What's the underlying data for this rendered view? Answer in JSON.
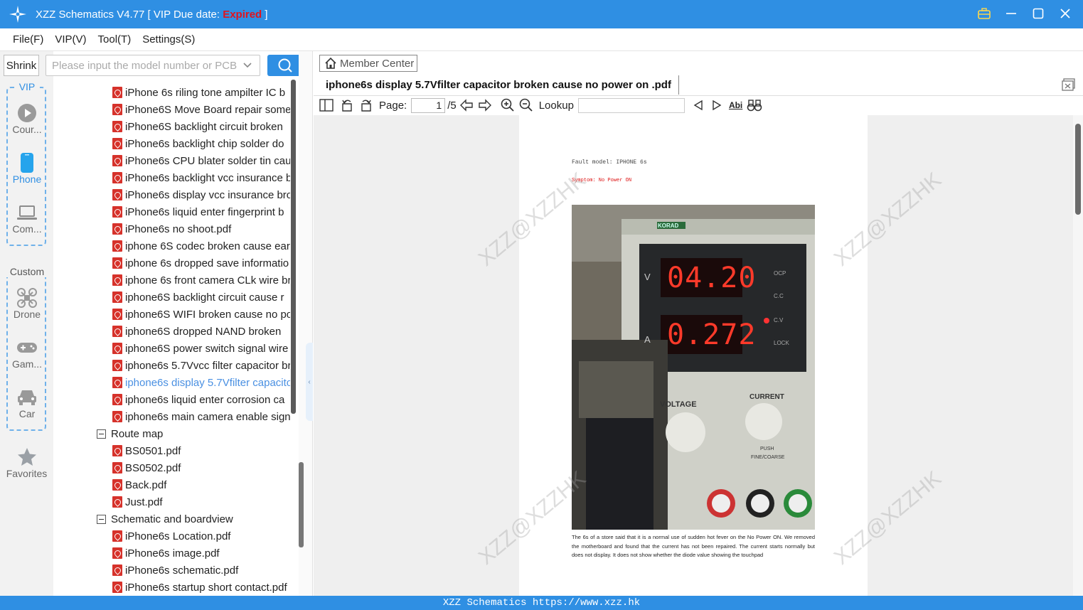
{
  "window": {
    "title_prefix": "XZZ Schematics V4.77 [ VIP Due date: ",
    "title_status": "Expired",
    "title_suffix": " ]"
  },
  "menu": [
    "File(F)",
    "VIP(V)",
    "Tool(T)",
    "Settings(S)"
  ],
  "sidebar": {
    "shrink_label": "Shrink",
    "search_placeholder": "Please input the model number or PCB",
    "vip_label": "VIP",
    "vip_items": [
      {
        "label": "Cour...",
        "icon": "play-circle-icon"
      },
      {
        "label": "Phone",
        "icon": "phone-icon"
      },
      {
        "label": "Com...",
        "icon": "laptop-icon"
      }
    ],
    "custom_label": "Custom",
    "custom_items": [
      {
        "label": "Drone",
        "icon": "drone-icon"
      },
      {
        "label": "Gam...",
        "icon": "gamepad-icon"
      },
      {
        "label": "Car",
        "icon": "car-icon"
      }
    ],
    "favorites_label": "Favorites"
  },
  "tree": {
    "files_a": [
      "iPhone 6s riling tone ampilter IC b",
      "iPhone6S Move Board repair some",
      "iPhone6S backlight circuit broken",
      "iPhone6s  backlight chip solder do",
      "iPhone6s CPU blater solder tin cau",
      "iPhone6s backlight vcc insurance b",
      "iPhone6s display vcc insurance bro",
      "iPhone6s liquid enter fingerprint b",
      "iPhone6s no shoot.pdf",
      "iphone 6S codec broken cause ear",
      "iphone 6s dropped save informatio",
      "iphone 6s front camera CLk wire br",
      "iphone6S  backlight circuit cause r",
      "iphone6S WIFI broken cause no po",
      "iphone6S dropped NAND broken",
      "iphone6S power switch signal wire",
      "iphone6s 5.7Vvcc filter capacitor br",
      "iphone6s display 5.7Vfilter capacito",
      "iphone6s liquid enter corrosion ca",
      "iphone6s main camera enable sign"
    ],
    "selected_index": 17,
    "folder_route": "Route map",
    "files_route": [
      "BS0501.pdf",
      "BS0502.pdf",
      "Back.pdf",
      "Just.pdf"
    ],
    "folder_schematic": "Schematic and boardview",
    "files_schematic": [
      "iPhone6s Location.pdf",
      "iPhone6s image.pdf",
      "iPhone6s schematic.pdf",
      "iPhone6s startup short contact.pdf"
    ]
  },
  "viewer": {
    "member_center": "Member Center",
    "doc_title": "iphone6s display 5.7Vfilter capacitor broken cause no power on .pdf",
    "page_label": "Page:",
    "page_current": "1",
    "page_total": "/5",
    "lookup_label": "Lookup",
    "page_content": {
      "fault_model": "Fault model: IPHONE 6s",
      "symptom": "Symptom: No Power ON",
      "psu_voltage": "04.20",
      "psu_current": "0.272",
      "psu_labels": [
        "V",
        "A",
        "OCP",
        "C.C",
        "C.V",
        "LOCK",
        "VOLTAGE",
        "CURRENT",
        "PUSH",
        "FINE/COARSE",
        "KORAD"
      ],
      "description": "The 6s of a store said that it is a normal use of sudden hot fever on the No Power ON. We removed the motherboard and found that the current has not been repaired. The current starts normally but does not display. It does not show whether the diode value showing the touchpad",
      "watermark": "XZZ@XZZHK"
    }
  },
  "status_bar": "XZZ Schematics https://www.xzz.hk",
  "colors": {
    "accent": "#2f8fe3",
    "expired": "#e0141e",
    "selected": "#4a90e2",
    "pdf": "#d6322b"
  }
}
